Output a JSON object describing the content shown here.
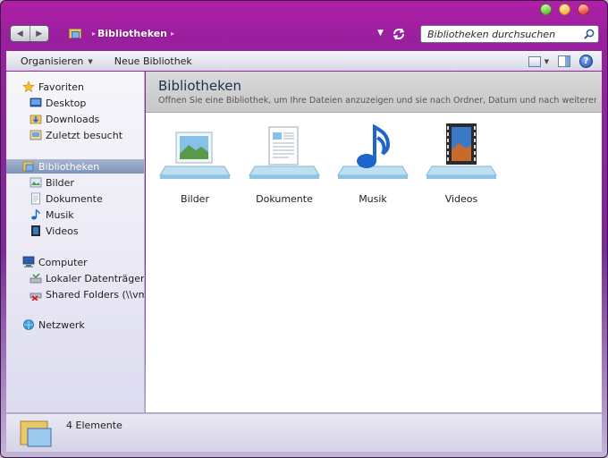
{
  "window": {
    "accent": "#9a1f9e",
    "caption_buttons": [
      "minimize",
      "maximize",
      "close"
    ]
  },
  "address": {
    "path": "Bibliotheken",
    "search_placeholder": "Bibliotheken durchsuchen"
  },
  "toolbar": {
    "organize": "Organisieren",
    "new_library": "Neue Bibliothek",
    "help": "?"
  },
  "nav": {
    "favorites": {
      "label": "Favoriten",
      "items": [
        "Desktop",
        "Downloads",
        "Zuletzt besucht"
      ]
    },
    "libraries": {
      "label": "Bibliotheken",
      "items": [
        "Bilder",
        "Dokumente",
        "Musik",
        "Videos"
      ]
    },
    "computer": {
      "label": "Computer",
      "items": [
        "Lokaler Datenträger (C:)",
        "Shared Folders (\\\\vmware-host) (Z:)"
      ]
    },
    "network": {
      "label": "Netzwerk"
    }
  },
  "content": {
    "title": "Bibliotheken",
    "description": "Öffnen Sie eine Bibliothek, um Ihre Dateien anzuzeigen und sie nach Ordner, Datum und nach weiteren Eigenschaften anzuordnen.",
    "libraries": [
      {
        "label": "Bilder",
        "icon": "pictures-library-icon"
      },
      {
        "label": "Dokumente",
        "icon": "documents-library-icon"
      },
      {
        "label": "Musik",
        "icon": "music-library-icon"
      },
      {
        "label": "Videos",
        "icon": "videos-library-icon"
      }
    ]
  },
  "status": {
    "count_text": "4 Elemente"
  }
}
